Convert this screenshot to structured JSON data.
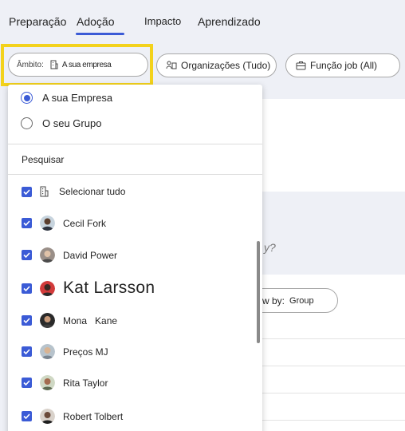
{
  "tabs": [
    "Preparação",
    "Adoção",
    "Impacto",
    "Aprendizado"
  ],
  "active_tab": "Adoção",
  "filters": {
    "scope_key": "Âmbito:",
    "scope_value": "A sua empresa",
    "organizations": "Organizações (Tudo)",
    "job_function": "Função job (All)"
  },
  "background": {
    "question_mark": "y?",
    "group_by_key": "w by:",
    "group_by_value": "Group"
  },
  "dropdown": {
    "options": [
      {
        "label": "A sua Empresa",
        "selected": true
      },
      {
        "label": "O seu Grupo",
        "selected": false
      }
    ],
    "search_label": "Pesquisar",
    "select_all": "Selecionar tudo",
    "people": [
      {
        "name": "Cecil Fork",
        "checked": true
      },
      {
        "name": "David Power",
        "checked": true
      },
      {
        "name": "Kat Larsson",
        "checked": true
      },
      {
        "name": "Mona   Kane",
        "checked": true
      },
      {
        "name": "Preços MJ",
        "checked": true
      },
      {
        "name": "Rita Taylor",
        "checked": true
      },
      {
        "name": "Robert Tolbert",
        "checked": true
      }
    ]
  },
  "colors": {
    "accent": "#3b5bd6",
    "highlight": "#f3d21c",
    "background": "#eef0f6"
  }
}
